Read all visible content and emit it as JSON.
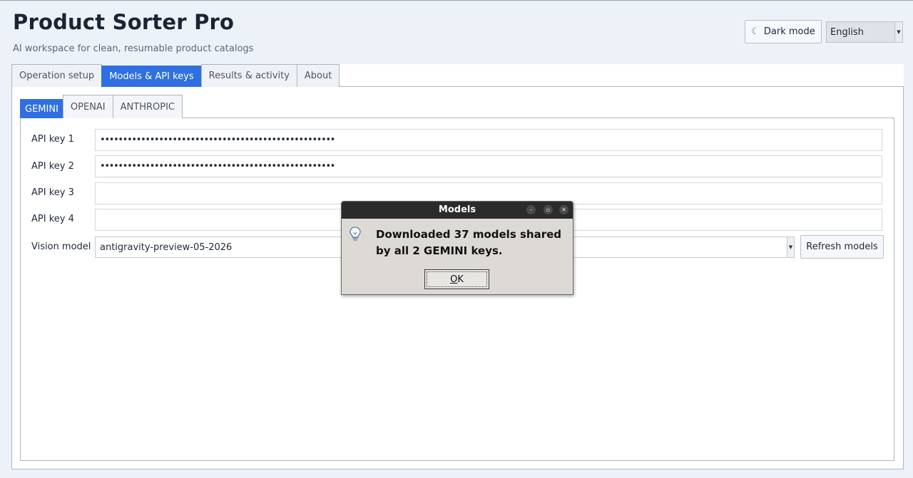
{
  "app": {
    "title": "Product Sorter Pro",
    "subtitle": "AI workspace for clean, resumable product catalogs"
  },
  "header": {
    "dark_mode_label": "Dark mode",
    "language_value": "English"
  },
  "outer_tabs": [
    {
      "label": "Operation setup",
      "active": false
    },
    {
      "label": "Models & API keys",
      "active": true
    },
    {
      "label": "Results & activity",
      "active": false
    },
    {
      "label": "About",
      "active": false
    }
  ],
  "provider_tabs": [
    {
      "label": "GEMINI",
      "active": true
    },
    {
      "label": "OPENAI",
      "active": false
    },
    {
      "label": "ANTHROPIC",
      "active": false
    }
  ],
  "api_keys": [
    {
      "label": "API key 1",
      "value": "••••••••••••••••••••••••••••••••••••••••••••••••••••"
    },
    {
      "label": "API key 2",
      "value": "••••••••••••••••••••••••••••••••••••••••••••••••••••"
    },
    {
      "label": "API key 3",
      "value": ""
    },
    {
      "label": "API key 4",
      "value": ""
    }
  ],
  "vision_model": {
    "label": "Vision model",
    "value": "antigravity-preview-05-2026",
    "refresh_label": "Refresh models"
  },
  "dialog": {
    "title": "Models",
    "message": "Downloaded 37 models shared by all 2 GEMINI keys.",
    "ok_label": "OK",
    "ok_rest": "K",
    "ok_mnemonic": "O"
  },
  "colors": {
    "accent": "#2f6fe0",
    "background": "#edf2f9",
    "dialog_titlebar": "#2b2b2b"
  },
  "icons": {
    "dark_mode": "moon-icon",
    "dialog": "lightbulb-icon"
  }
}
